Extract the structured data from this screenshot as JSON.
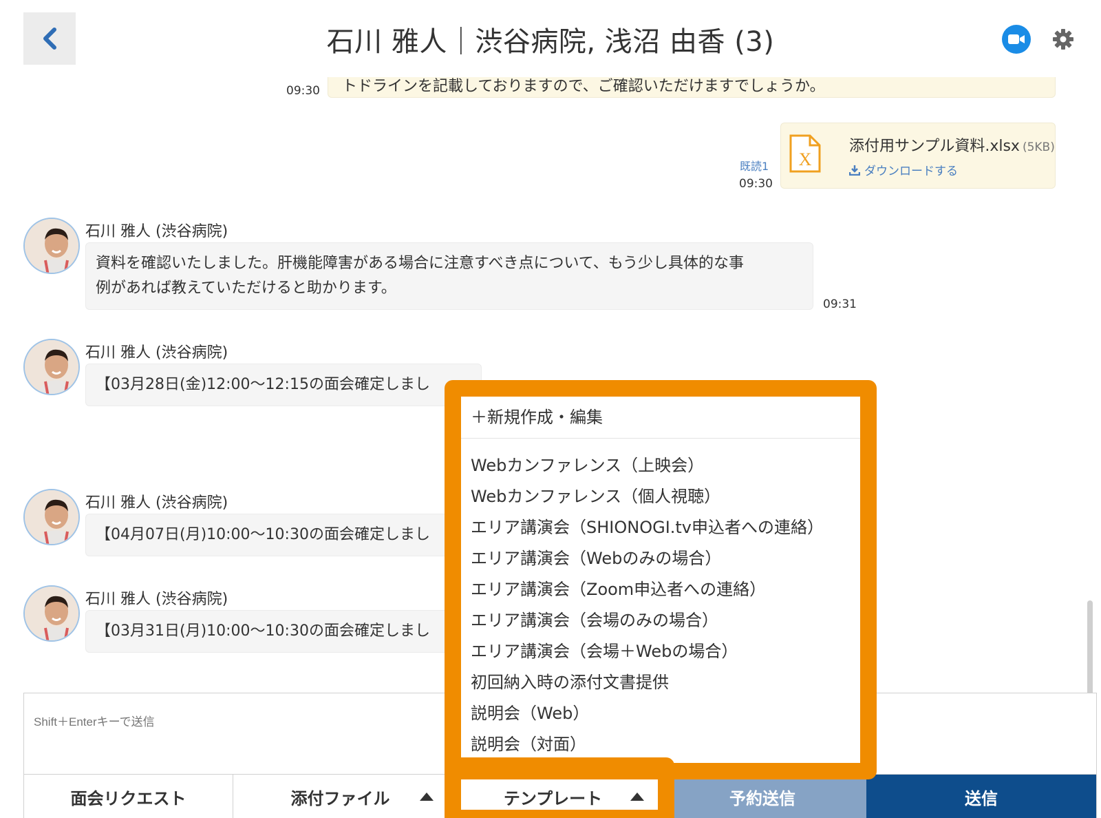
{
  "header": {
    "title": "石川 雅人｜渋谷病院, 浅沼 由香 (3)",
    "back_icon": "chevron-left-icon",
    "video_icon": "video-call-icon",
    "settings_icon": "gear-icon"
  },
  "messages": {
    "partial_top": {
      "text": "トドラインを記載しておりますので、ご確認いただけますでしょうか。",
      "time": "09:30"
    },
    "attachment": {
      "file_name": "添付用サンプル資料.xlsx",
      "file_size": "(5KB)",
      "download_label": "ダウンロードする",
      "read_label": "既読1",
      "time": "09:30"
    },
    "msg1": {
      "sender": "石川 雅人 (渋谷病院)",
      "text_line1": "資料を確認いたしました。肝機能障害がある場合に注意すべき点について、もう少し具体的な事",
      "text_line2": "例があれば教えていただけると助かります。",
      "time": "09:31"
    },
    "msg2": {
      "sender": "石川 雅人 (渋谷病院)",
      "text": "【03月28日(金)12:00〜12:15の面会確定しまし"
    },
    "msg3": {
      "sender": "石川 雅人 (渋谷病院)",
      "text": "【04月07日(月)10:00〜10:30の面会確定しまし"
    },
    "msg4": {
      "sender": "石川 雅人 (渋谷病院)",
      "text": "【03月31日(月)10:00〜10:30の面会確定しまし"
    }
  },
  "composer": {
    "placeholder": "Shift＋Enterキーで送信"
  },
  "toolbar": {
    "meeting_request": "面会リクエスト",
    "attach_file": "添付ファイル",
    "template": "テンプレート",
    "scheduled_send": "予約送信",
    "send": "送信"
  },
  "template_menu": {
    "new_edit": "＋新規作成・編集",
    "items": [
      "Webカンファレンス（上映会）",
      "Webカンファレンス（個人視聴）",
      "エリア講演会（SHIONOGI.tv申込者への連絡）",
      "エリア講演会（Webのみの場合）",
      "エリア講演会（Zoom申込者への連絡）",
      "エリア講演会（会場のみの場合）",
      "エリア講演会（会場＋Webの場合）",
      "初回納入時の添付文書提供",
      "説明会（Web）",
      "説明会（対面）"
    ]
  },
  "colors": {
    "highlight": "#f08c00",
    "send_button": "#0e4d8c",
    "scheduled_button": "#86a3c5",
    "own_bubble": "#fcf7e3",
    "link": "#4a7fc0"
  }
}
